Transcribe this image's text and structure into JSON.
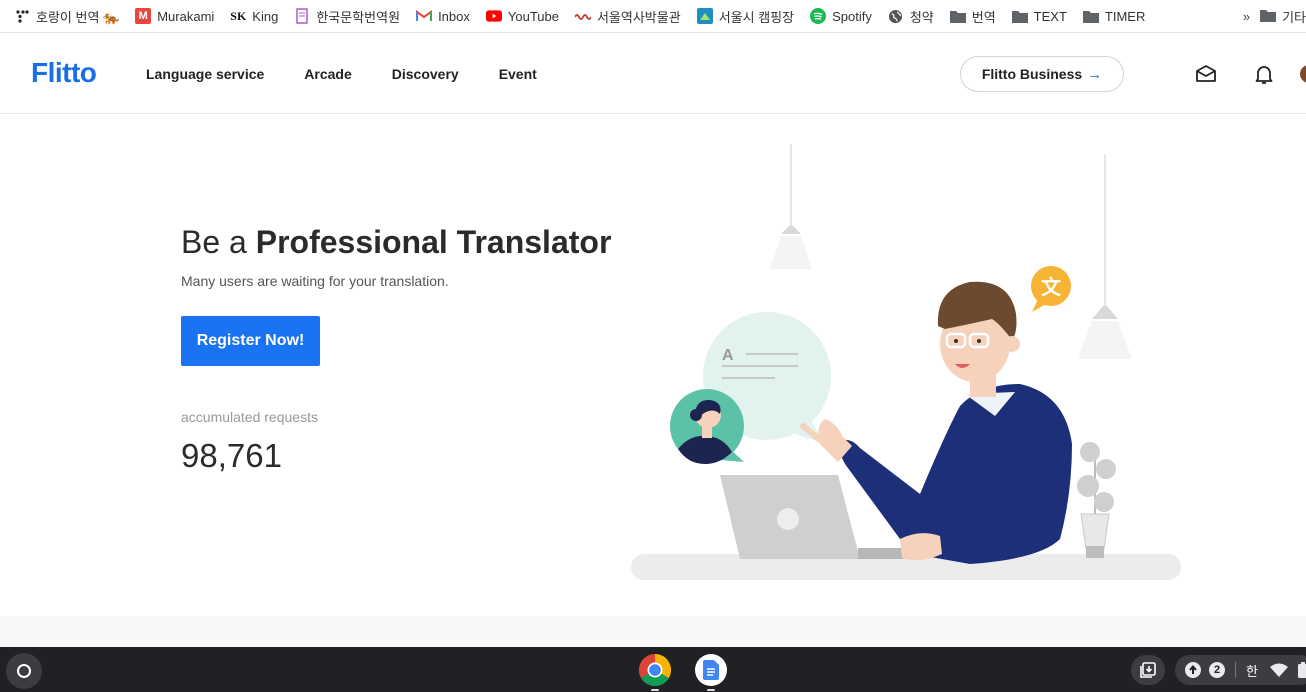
{
  "bookmarks": [
    {
      "label": "호랑이 번역 🐅",
      "icon": "dots-icon"
    },
    {
      "label": "Murakami",
      "icon": "m-logo-icon",
      "color": "#e8453c"
    },
    {
      "label": "King",
      "icon": "sk-logo-icon"
    },
    {
      "label": "한국문학번역원",
      "icon": "book-icon"
    },
    {
      "label": "Inbox",
      "icon": "gmail-icon"
    },
    {
      "label": "YouTube",
      "icon": "youtube-icon",
      "color": "#ff0000"
    },
    {
      "label": "서울역사박물관",
      "icon": "wave-icon"
    },
    {
      "label": "서울시 캠핑장",
      "icon": "camping-icon"
    },
    {
      "label": "Spotify",
      "icon": "spotify-icon",
      "color": "#1db954"
    },
    {
      "label": "청약",
      "icon": "globe-icon"
    },
    {
      "label": "번역",
      "icon": "folder-icon"
    },
    {
      "label": "TEXT",
      "icon": "folder-icon"
    },
    {
      "label": "TIMER",
      "icon": "folder-icon"
    }
  ],
  "bookmarks_overflow": {
    "chevron": "»",
    "label": "기타"
  },
  "header": {
    "logo": "Flitto",
    "nav": [
      "Language service",
      "Arcade",
      "Discovery",
      "Event"
    ],
    "business_button": "Flitto Business",
    "business_arrow": "→"
  },
  "hero": {
    "title_prefix": "Be a ",
    "title_bold": "Professional Translator",
    "subtitle": "Many users are waiting for your translation.",
    "register_button": "Register Now!",
    "accumulated_label": "accumulated requests",
    "accumulated_value": "98,761",
    "bubble_letter": "A",
    "translate_badge": "文"
  },
  "taskbar": {
    "tray_badge": "2",
    "ime": "한"
  },
  "colors": {
    "brand": "#1a6fe8",
    "button": "#1a73f0",
    "sweater": "#1e2f7a"
  }
}
